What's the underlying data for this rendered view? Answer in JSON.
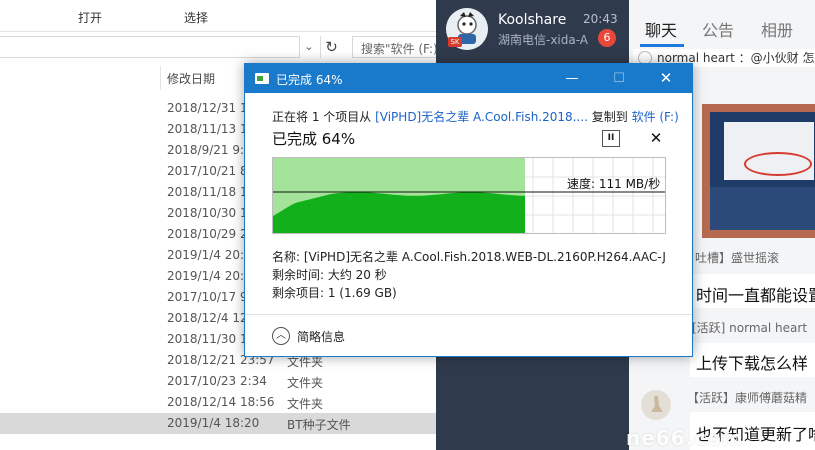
{
  "explorer": {
    "ribbon": {
      "open_label": "打开",
      "select_label": "选择"
    },
    "address": {
      "dropdown_glyph": "⌄",
      "refresh_glyph": "↻"
    },
    "search": {
      "placeholder": "搜索\"软件 (F:)\""
    },
    "columns": {
      "date_modified": "修改日期"
    },
    "rows": [
      {
        "date": "2018/12/31 1",
        "type": ""
      },
      {
        "date": "2018/11/13 1",
        "type": ""
      },
      {
        "date": "2018/9/21 9:1",
        "type": ""
      },
      {
        "date": "2017/10/21 8",
        "type": ""
      },
      {
        "date": "2018/11/18 1",
        "type": ""
      },
      {
        "date": "2018/10/30 1",
        "type": ""
      },
      {
        "date": "2018/10/29 2",
        "type": ""
      },
      {
        "date": "2019/1/4 20:2",
        "type": ""
      },
      {
        "date": "2019/1/4 20:1",
        "type": ""
      },
      {
        "date": "2017/10/17 9",
        "type": ""
      },
      {
        "date": "2018/12/4 12",
        "type": ""
      },
      {
        "date": "2018/11/30 1",
        "type": ""
      },
      {
        "date": "2018/12/21 23:57",
        "type": "文件夹"
      },
      {
        "date": "2017/10/23 2:34",
        "type": "文件夹"
      },
      {
        "date": "2018/12/14 18:56",
        "type": "文件夹"
      },
      {
        "date": "2019/1/4 18:20",
        "type": "BT种子文件"
      }
    ]
  },
  "chat": {
    "contact": {
      "name": "Koolshare",
      "time": "20:43",
      "subtitle": "湖南电信-xida-A",
      "unread": "6",
      "avatar_badge": "SK"
    },
    "tabs": [
      "聊天",
      "公告",
      "相册"
    ],
    "messages": {
      "m1": "normal heart ：@小伙财 怎么",
      "m2_meta": "吐槽】盛世摇滚",
      "m2_text": "时间一直都能设置",
      "m3_meta": "[活跃] normal heart",
      "m3_text": "上传下载怎么样",
      "m4_meta": "【活跃】康师傅蘑菇精",
      "m4_text": "也不知道更新了啥"
    },
    "watermark": "ne66.com"
  },
  "dialog": {
    "title": "已完成 64%",
    "controls": {
      "minimize": "—",
      "maximize": "☐",
      "close": "✕"
    },
    "desc_prefix": "正在将 1 个项目从 ",
    "desc_source": "[ViPHD]无名之辈 A.Cool.Fish.2018....",
    "desc_mid": " 复制到 ",
    "desc_dest": "软件 (F:)",
    "status": "已完成 64%",
    "pause_glyph": "II",
    "cancel_glyph": "✕",
    "speed": "速度: 111 MB/秒",
    "progress": 0.64,
    "name_label": "名称: [ViPHD]无名之辈 A.Cool.Fish.2018.WEB-DL.2160P.H264.AAC-J...",
    "time_label": "剩余时间: 大约 20 秒",
    "items_label": "剩余项目: 1 (1.69 GB)",
    "less_glyph": "︿",
    "less_label": "简略信息",
    "colors": {
      "title_bar": "#1979ca",
      "fill_light": "#a6e39a",
      "fill_dark": "#12b01b",
      "link": "#1c64c8"
    }
  }
}
